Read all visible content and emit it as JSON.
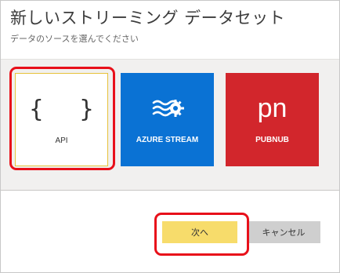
{
  "dialog": {
    "title": "新しいストリーミング データセット",
    "subtitle": "データのソースを選んでください"
  },
  "tiles": [
    {
      "label": "API",
      "icon": "braces-icon",
      "color": "#ffffff",
      "selected": true
    },
    {
      "label": "AZURE STREAM",
      "icon": "azure-stream-gear-icon",
      "color": "#0a72d4",
      "selected": false
    },
    {
      "label": "PUBNUB",
      "icon": "pubnub-logo",
      "color": "#d2262c",
      "selected": false,
      "logo_text": "pn"
    }
  ],
  "api_icon": {
    "glyph": "{ }"
  },
  "buttons": {
    "next_label": "次へ",
    "cancel_label": "キャンセル"
  },
  "colors": {
    "highlight": "#e8101a",
    "selected_border": "#e6c23a",
    "primary_button": "#f7dc6b",
    "secondary_button": "#cfcfcf",
    "tile_area_background": "#f1f0ef"
  }
}
